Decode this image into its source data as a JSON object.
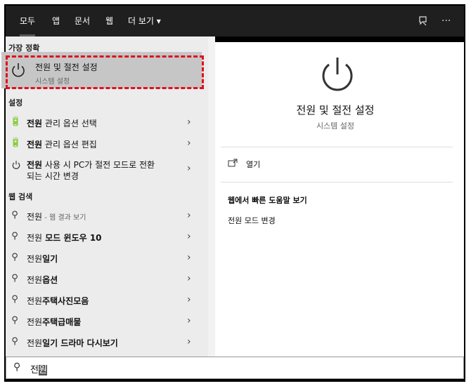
{
  "tabs": [
    "모두",
    "앱",
    "문서",
    "웹",
    "더 보기 ▾"
  ],
  "top_icons": {
    "feedback": "feedback-icon",
    "more": "···"
  },
  "sections": {
    "best": "가장 정확",
    "settings": "설정",
    "web": "웹 검색"
  },
  "best_match": {
    "title": "전원 및 절전 설정",
    "subtitle": "시스템 설정"
  },
  "settings_items": [
    {
      "bold": "전원",
      "rest": " 관리 옵션 선택"
    },
    {
      "bold": "전원",
      "rest": " 관리 옵션 편집"
    },
    {
      "bold": "전원",
      "rest": " 사용 시 PC가 절전 모드로 전환",
      "line2": "되는 시간 변경"
    }
  ],
  "web_items": [
    {
      "bold": "전원",
      "rest": " - 웹 결과 보기"
    },
    {
      "bold": "전원",
      "rest": " 모드 윈도우 10"
    },
    {
      "bold": "전원",
      "rest": "일기"
    },
    {
      "bold": "전원",
      "rest": "옵션"
    },
    {
      "bold": "전원",
      "rest": "주택사진모음"
    },
    {
      "bold": "전원",
      "rest": "주택급매물"
    },
    {
      "bold": "전원",
      "rest": "일기 드라마 다시보기"
    }
  ],
  "preview": {
    "title": "전원 및 절전 설정",
    "subtitle": "시스템 설정",
    "open_label": "열기",
    "help_header": "웹에서 빠른 도움말 보기",
    "help_link": "전원 모드 변경"
  },
  "search": {
    "typed": "전",
    "selected": "원"
  }
}
